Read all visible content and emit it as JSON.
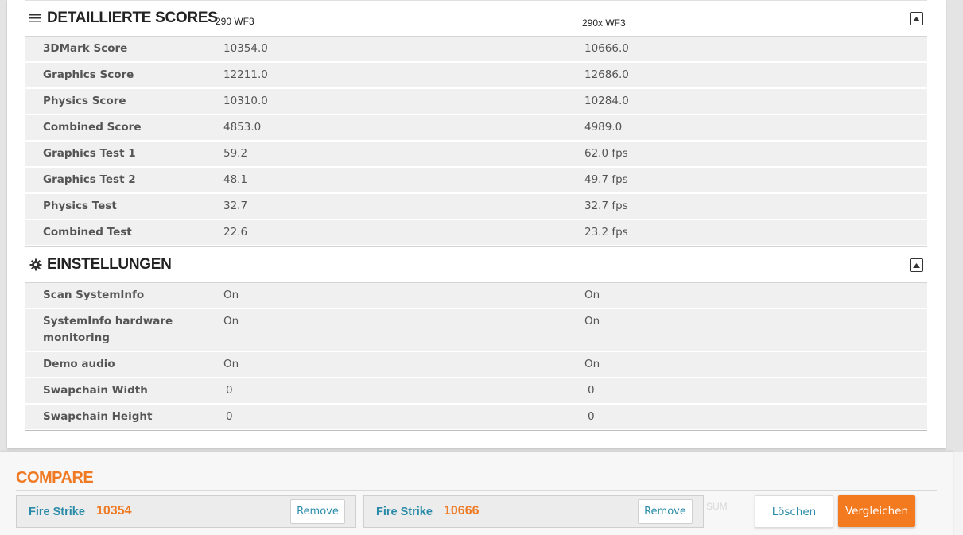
{
  "scores_section": {
    "title": "DETAILLIERTE SCORES",
    "icon": "list-icon",
    "col1": "290 WF3",
    "col2": "290x WF3",
    "rows": [
      {
        "label": "3DMark Score",
        "v1": "10354.0",
        "v2": "10666.0"
      },
      {
        "label": "Graphics Score",
        "v1": "12211.0",
        "v2": "12686.0"
      },
      {
        "label": "Physics Score",
        "v1": "10310.0",
        "v2": "10284.0"
      },
      {
        "label": "Combined Score",
        "v1": "4853.0",
        "v2": "4989.0"
      },
      {
        "label": "Graphics Test 1",
        "v1": "59.2",
        "v2": "62.0 fps"
      },
      {
        "label": "Graphics Test 2",
        "v1": "48.1",
        "v2": "49.7 fps"
      },
      {
        "label": "Physics Test",
        "v1": "32.7",
        "v2": "32.7 fps"
      },
      {
        "label": "Combined Test",
        "v1": "22.6",
        "v2": "23.2 fps"
      }
    ]
  },
  "settings_section": {
    "title": "EINSTELLUNGEN",
    "icon": "gear-icon",
    "rows": [
      {
        "label": "Scan SystemInfo",
        "v1": "On",
        "v2": "On"
      },
      {
        "label": "SystemInfo hardware monitoring",
        "v1": "On",
        "v2": "On"
      },
      {
        "label": "Demo audio",
        "v1": "On",
        "v2": "On"
      },
      {
        "label": "Swapchain Width",
        "v1": "0",
        "v2": "0"
      },
      {
        "label": "Swapchain Height",
        "v1": "0",
        "v2": "0"
      }
    ]
  },
  "compare": {
    "title": "COMPARE",
    "slots": [
      {
        "name": "Fire Strike",
        "score": "10354",
        "remove_label": "Remove"
      },
      {
        "name": "Fire Strike",
        "score": "10666",
        "remove_label": "Remove"
      }
    ],
    "ghost_text": "SUM",
    "clear_label": "Löschen",
    "compare_label": "Vergleichen"
  },
  "colors": {
    "accent_orange": "#f47a20",
    "link_teal": "#2a8ba8",
    "row_bg": "#f0f0f0"
  }
}
